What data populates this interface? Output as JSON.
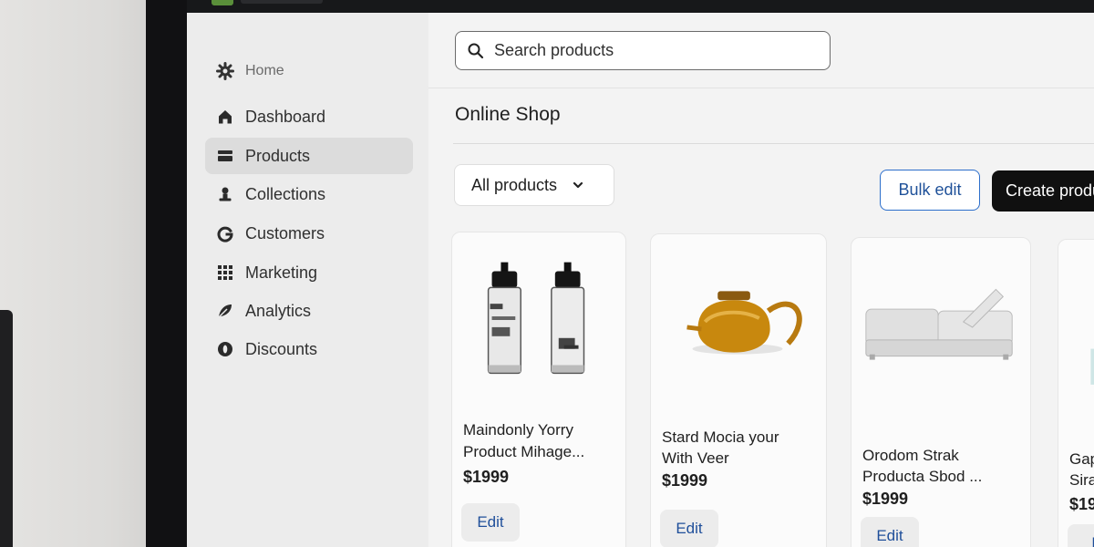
{
  "sidebar": {
    "items": [
      {
        "label": "Home",
        "icon": "gear-icon"
      },
      {
        "label": "Dashboard",
        "icon": "home-icon"
      },
      {
        "label": "Products",
        "icon": "products-icon",
        "active": true
      },
      {
        "label": "Collections",
        "icon": "person-icon"
      },
      {
        "label": "Customers",
        "icon": "google-g-icon"
      },
      {
        "label": "Marketing",
        "icon": "grid-icon"
      },
      {
        "label": "Analytics",
        "icon": "leaf-icon"
      },
      {
        "label": "Discounts",
        "icon": "discount-icon"
      }
    ]
  },
  "search": {
    "placeholder": "Search products"
  },
  "page": {
    "title": "Online Shop"
  },
  "toolbar": {
    "filter_label": "All products",
    "bulk_edit_label": "Bulk edit",
    "create_label": "Create product"
  },
  "products": [
    {
      "name_line1": "Maindonly Yorry",
      "name_line2": "Product Mihage...",
      "price": "$1999",
      "edit_label": "Edit",
      "image": "water-bottles"
    },
    {
      "name_line1": "Stard Mocia your",
      "name_line2": "With Veer",
      "price": "$1999",
      "edit_label": "Edit",
      "image": "amber-teapot"
    },
    {
      "name_line1": "Orodom Strak",
      "name_line2": "Producta Sbod ...",
      "price": "$1999",
      "edit_label": "Edit",
      "image": "white-lounger"
    },
    {
      "name_line1": "Gap",
      "name_line2": "Sira",
      "price": "$19",
      "edit_label": "E",
      "image": "partial-product"
    }
  ],
  "colors": {
    "accent_blue": "#2c6ecb",
    "primary_button": "#101010",
    "sidebar_active": "#dcdcdc",
    "brand_green": "#5a8f3a"
  }
}
